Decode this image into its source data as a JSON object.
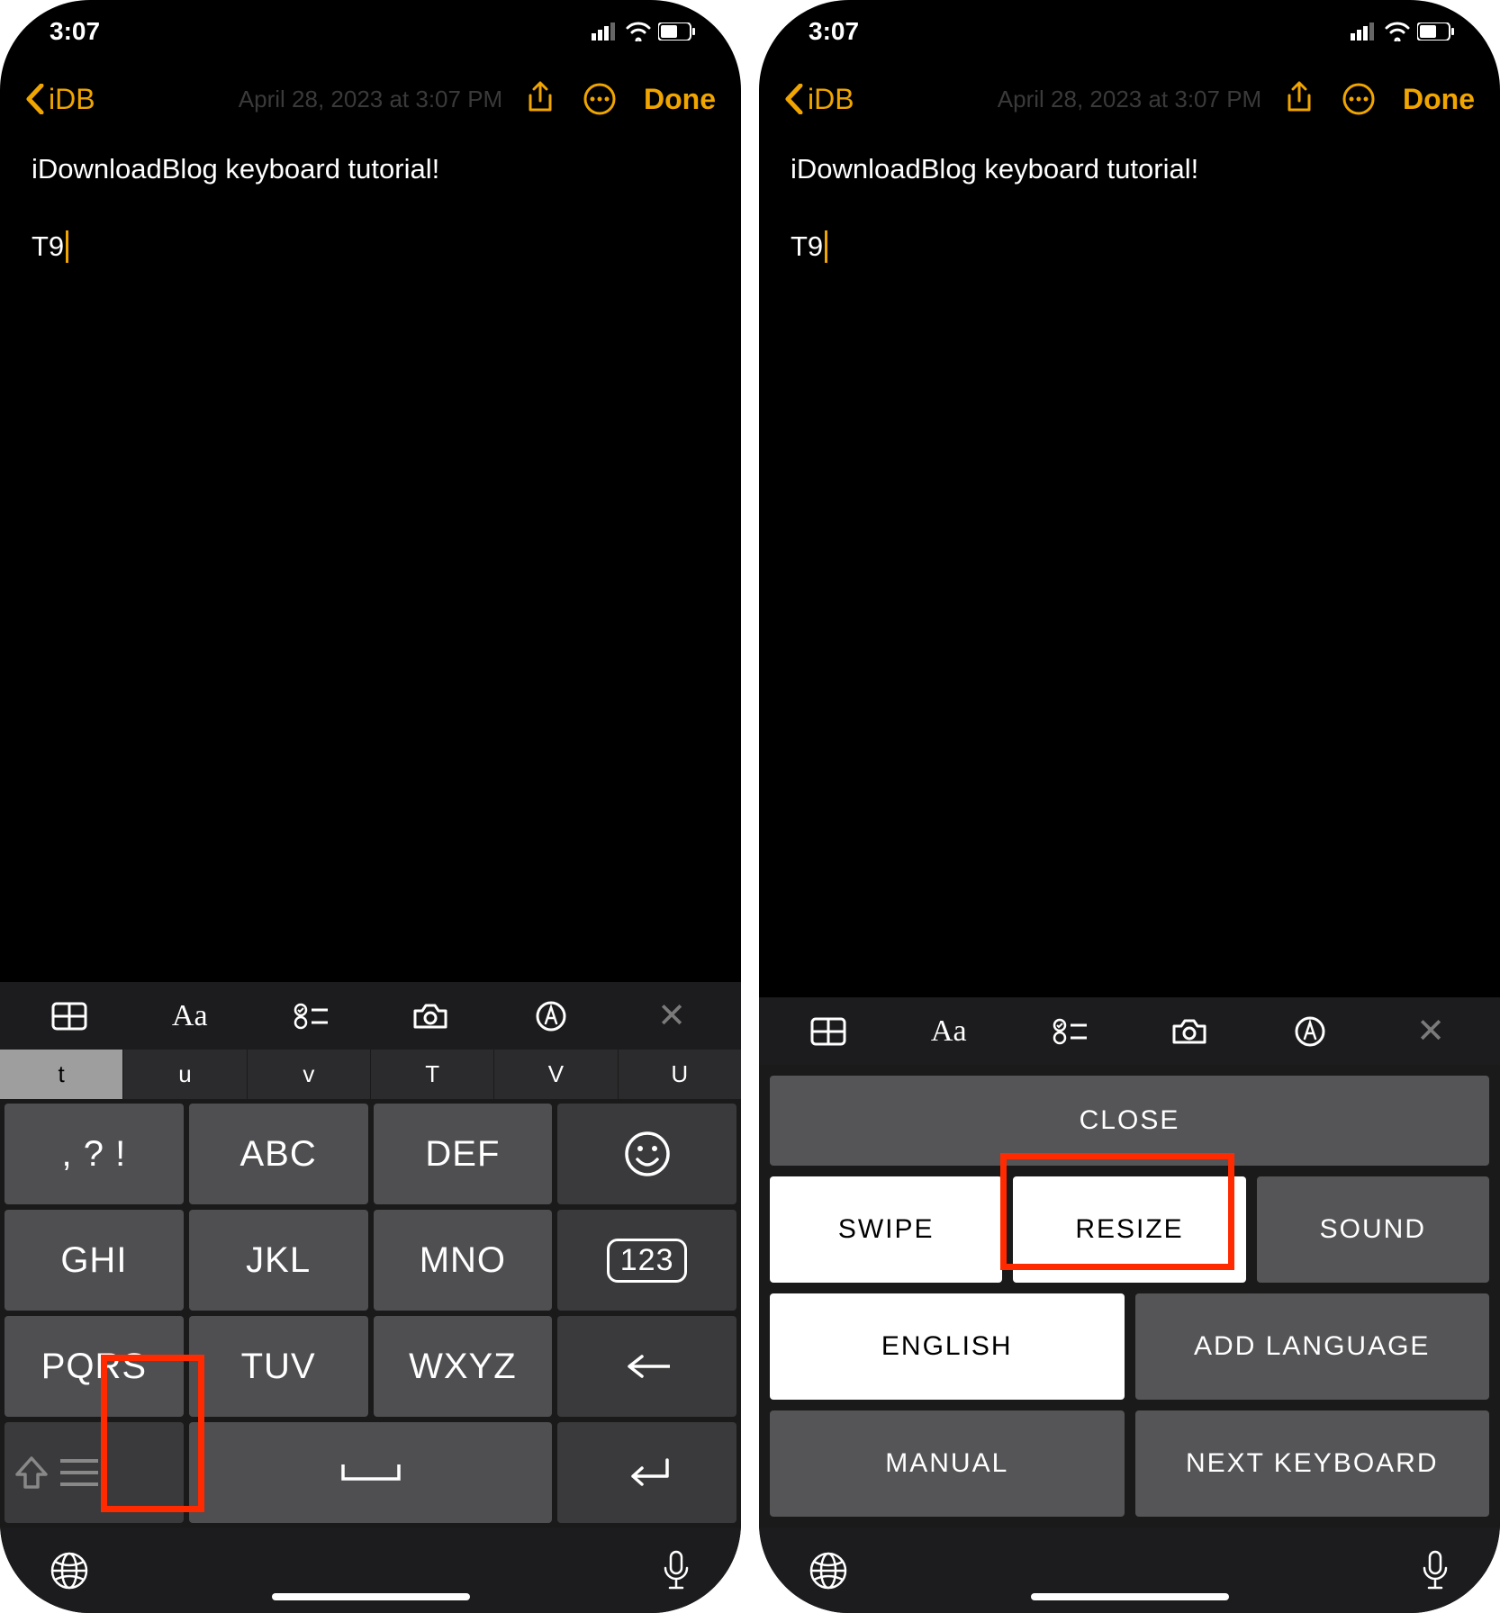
{
  "status": {
    "time": "3:07"
  },
  "nav": {
    "back": "iDB",
    "done": "Done"
  },
  "faded_date": "April 28, 2023 at 3:07 PM",
  "note": {
    "title": "iDownloadBlog keyboard tutorial!",
    "body": "T9"
  },
  "suggestions": [
    "t",
    "u",
    "v",
    "T",
    "V",
    "U"
  ],
  "t9": {
    "r1": [
      ", ? !",
      "ABC",
      "DEF"
    ],
    "r2": [
      "GHI",
      "JKL",
      "MNO"
    ],
    "r3": [
      "PQRS",
      "TUV",
      "WXYZ"
    ],
    "num": "123"
  },
  "menu": {
    "close": "CLOSE",
    "swipe": "SWIPE",
    "resize": "RESIZE",
    "sound": "SOUND",
    "english": "ENGLISH",
    "addlang": "ADD LANGUAGE",
    "manual": "MANUAL",
    "nextkb": "NEXT KEYBOARD"
  }
}
